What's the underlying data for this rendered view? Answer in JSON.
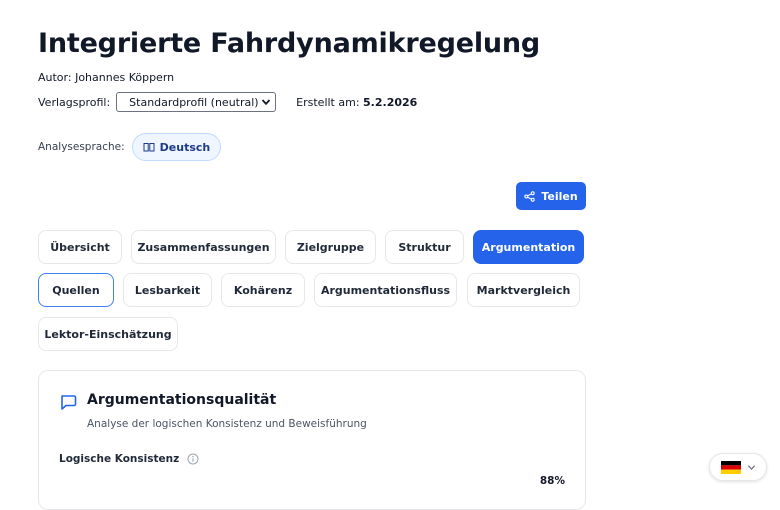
{
  "header": {
    "title": "Integrierte Fahrdynamikregelung",
    "author": "Autor: Johannes Köppern",
    "profile_label": "Verlagsprofil:",
    "profile_value": "Standardprofil (neutral)",
    "created_label": "Erstellt am:",
    "created_value": "5.2.2026"
  },
  "language": {
    "label": "Analysesprache:",
    "value": "Deutsch",
    "icon": "book-icon"
  },
  "share": {
    "label": "Teilen",
    "icon": "share-icon"
  },
  "tabs": [
    {
      "label": "Übersicht"
    },
    {
      "label": "Zusammenfassungen"
    },
    {
      "label": "Zielgruppe"
    },
    {
      "label": "Struktur"
    },
    {
      "label": "Argumentation"
    },
    {
      "label": "Quellen"
    },
    {
      "label": "Lesbarkeit"
    },
    {
      "label": "Kohärenz"
    },
    {
      "label": "Argumentationsfluss"
    },
    {
      "label": "Marktvergleich"
    },
    {
      "label": "Lektor-Einschätzung"
    }
  ],
  "active_tab": "Argumentation",
  "card": {
    "icon": "chat-icon",
    "title": "Argumentationsqualität",
    "subtitle": "Analyse der logischen Konsistenz und Beweisführung",
    "metric_label": "Logische Konsistenz",
    "metric_value": "88%"
  },
  "locale_switcher": {
    "flag": "german-flag-icon"
  },
  "colors": {
    "accent": "#2563eb",
    "pill_bg": "#eff6ff"
  }
}
